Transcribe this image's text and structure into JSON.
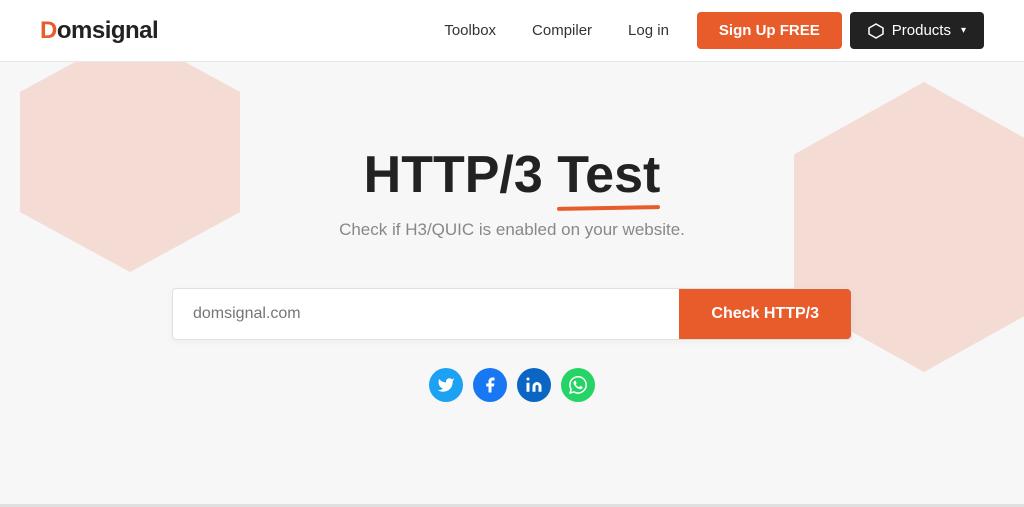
{
  "navbar": {
    "logo_d": "D",
    "logo_rest": "omsignal",
    "nav_links": [
      {
        "label": "Toolbox",
        "href": "#"
      },
      {
        "label": "Compiler",
        "href": "#"
      },
      {
        "label": "Log in",
        "href": "#"
      }
    ],
    "signup_label": "Sign Up FREE",
    "products_label": "Products"
  },
  "hero": {
    "title_part1": "HTTP/3",
    "title_part2": "Test",
    "subtitle": "Check if H3/QUIC is enabled on your website.",
    "input_placeholder": "domsignal.com",
    "check_button_label": "Check HTTP/3"
  },
  "social": {
    "twitter_title": "Twitter",
    "facebook_title": "Facebook",
    "linkedin_title": "LinkedIn",
    "whatsapp_title": "WhatsApp"
  }
}
